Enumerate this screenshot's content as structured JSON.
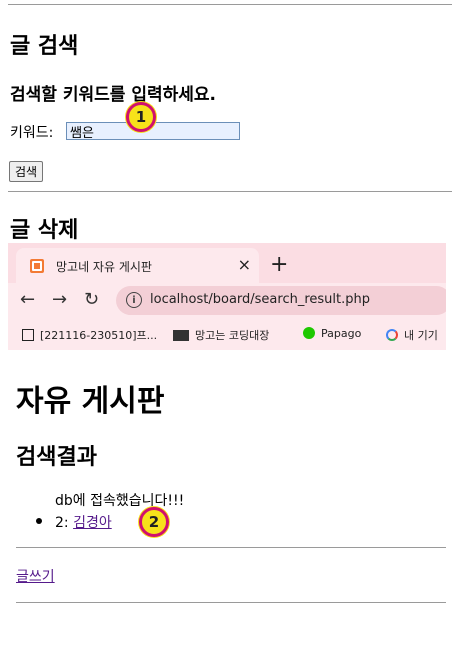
{
  "search_section": {
    "title": "글 검색",
    "prompt": "검색할 키워드를 입력하세요.",
    "keyword_label": "키워드:",
    "keyword_value": "쌤은",
    "search_button": "검색"
  },
  "delete_section": {
    "title": "글 삭제"
  },
  "browser": {
    "tab_title": "망고네 자유 게시판",
    "tab_close": "×",
    "new_tab": "+",
    "url": "localhost/board/search_result.php",
    "bookmarks": [
      {
        "label": "[221116-230510]프...",
        "icon": "notion-icon"
      },
      {
        "label": "망고는 코딩대장",
        "icon": "monitor-icon"
      },
      {
        "label": "Papago",
        "icon": "papago-icon"
      },
      {
        "label": "내 기기",
        "icon": "google-icon"
      }
    ]
  },
  "result_page": {
    "title": "자유 게시판",
    "subtitle": "검색결과",
    "db_message": "db에 접속했습니다!!!",
    "results": [
      {
        "prefix": "2:",
        "link": "김경아"
      }
    ],
    "write_link": "글쓰기"
  },
  "annotations": [
    "1",
    "2"
  ],
  "colors": {
    "badge_fill": "#f7e21a",
    "badge_border": "#d0106e",
    "browser_bg": "#fbdde3"
  }
}
